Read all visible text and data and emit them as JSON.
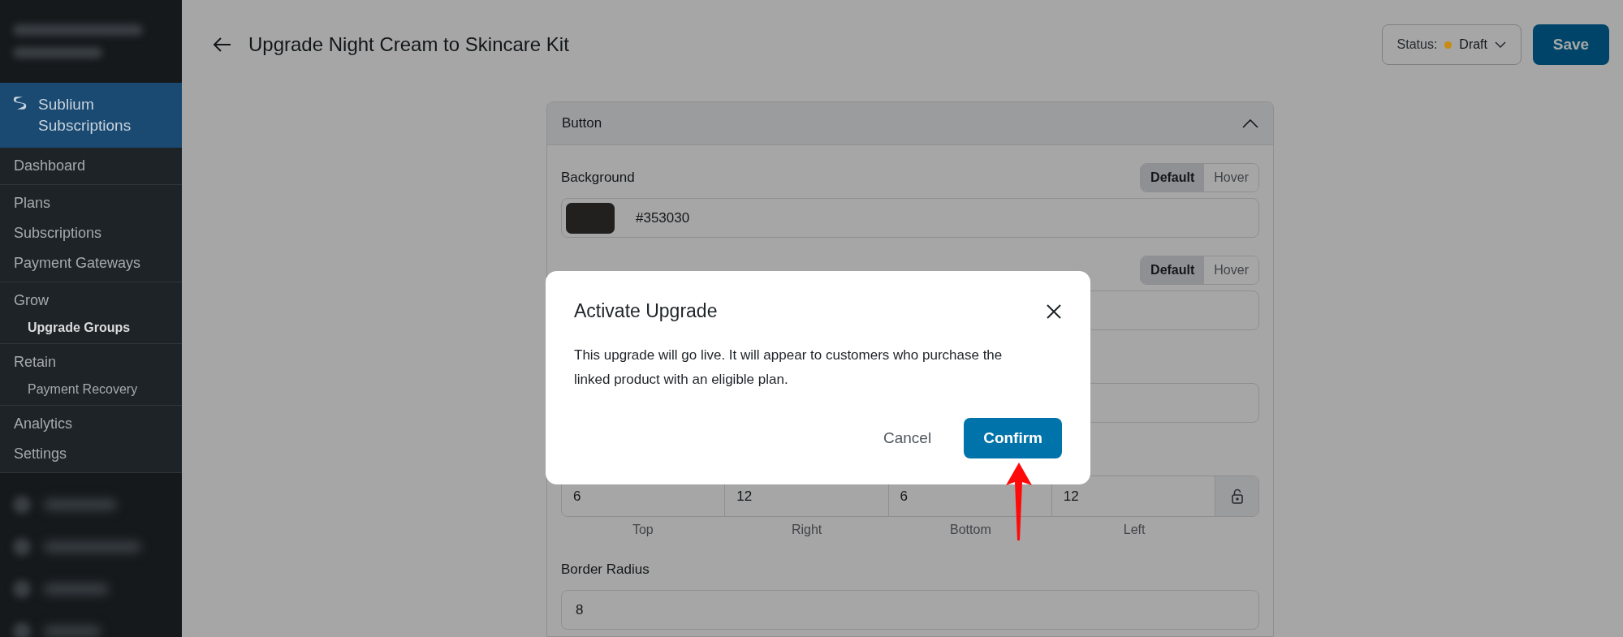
{
  "sidebar": {
    "brand": "Sublium Subscriptions",
    "sections": [
      {
        "items": [
          {
            "label": "Dashboard",
            "selected": false
          }
        ]
      },
      {
        "items": [
          {
            "label": "Plans",
            "selected": false
          },
          {
            "label": "Subscriptions",
            "selected": false
          },
          {
            "label": "Payment Gateways",
            "selected": false
          }
        ]
      },
      {
        "items": [
          {
            "label": "Grow",
            "selected": false,
            "children": [
              {
                "label": "Upgrade Groups",
                "selected": true
              }
            ]
          }
        ]
      },
      {
        "items": [
          {
            "label": "Retain",
            "selected": false,
            "children": [
              {
                "label": "Payment Recovery",
                "selected": false
              }
            ]
          }
        ]
      },
      {
        "items": [
          {
            "label": "Analytics",
            "selected": false
          },
          {
            "label": "Settings",
            "selected": false
          }
        ]
      }
    ]
  },
  "header": {
    "title": "Upgrade Night Cream to Skincare Kit",
    "status": {
      "label": "Status:",
      "value": "Draft",
      "color": "#c98a12"
    },
    "save": "Save"
  },
  "card": {
    "title": "Button",
    "expanded": true,
    "rows": [
      {
        "kind": "color",
        "label": "Background",
        "value": "#353030",
        "toggle": [
          {
            "label": "Default",
            "selected": true
          },
          {
            "label": "Hover",
            "selected": false
          }
        ]
      },
      {
        "kind": "text",
        "toggle": [
          {
            "label": "Default",
            "selected": true
          },
          {
            "label": "Hover",
            "selected": false
          }
        ]
      },
      {
        "kind": "text"
      },
      {
        "kind": "spacing",
        "locked": false,
        "sides": [
          {
            "value": "6",
            "label": "Top"
          },
          {
            "value": "12",
            "label": "Right"
          },
          {
            "value": "6",
            "label": "Bottom"
          },
          {
            "value": "12",
            "label": "Left"
          }
        ]
      },
      {
        "kind": "text",
        "label": "Border Radius",
        "value": "8"
      }
    ]
  },
  "modal": {
    "title": "Activate Upgrade",
    "body": "This upgrade will go live. It will appear to customers who purchase the linked product with an eligible plan.",
    "cancel": "Cancel",
    "confirm": "Confirm"
  }
}
